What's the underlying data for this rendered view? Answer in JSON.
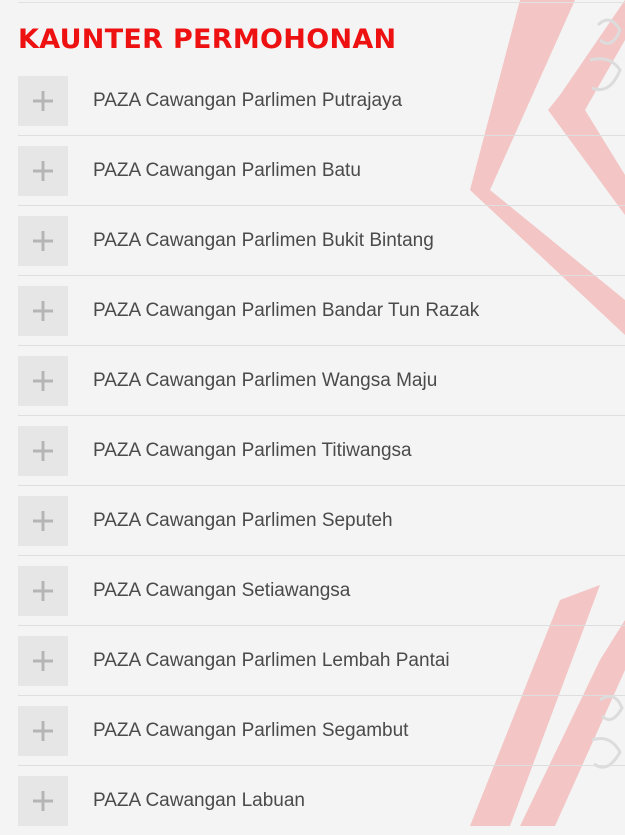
{
  "theme": {
    "title_color": "#ee1111",
    "label_color": "#4a4a4a",
    "icon_color": "#b5b5b5",
    "deco_color": "#f3c5c5"
  },
  "section": {
    "title": "KAUNTER PERMOHONAN"
  },
  "accordion": {
    "expand_icon": "plus-icon",
    "items": [
      {
        "label": "PAZA Cawangan Parlimen Putrajaya"
      },
      {
        "label": "PAZA Cawangan Parlimen Batu"
      },
      {
        "label": "PAZA Cawangan Parlimen Bukit Bintang"
      },
      {
        "label": "PAZA Cawangan Parlimen Bandar Tun Razak"
      },
      {
        "label": "PAZA Cawangan Parlimen Wangsa Maju"
      },
      {
        "label": "PAZA Cawangan Parlimen Titiwangsa"
      },
      {
        "label": "PAZA Cawangan Parlimen Seputeh"
      },
      {
        "label": "PAZA Cawangan Setiawangsa"
      },
      {
        "label": "PAZA Cawangan Parlimen Lembah Pantai"
      },
      {
        "label": "PAZA Cawangan Parlimen Segambut"
      },
      {
        "label": "PAZA Cawangan Labuan"
      }
    ]
  }
}
